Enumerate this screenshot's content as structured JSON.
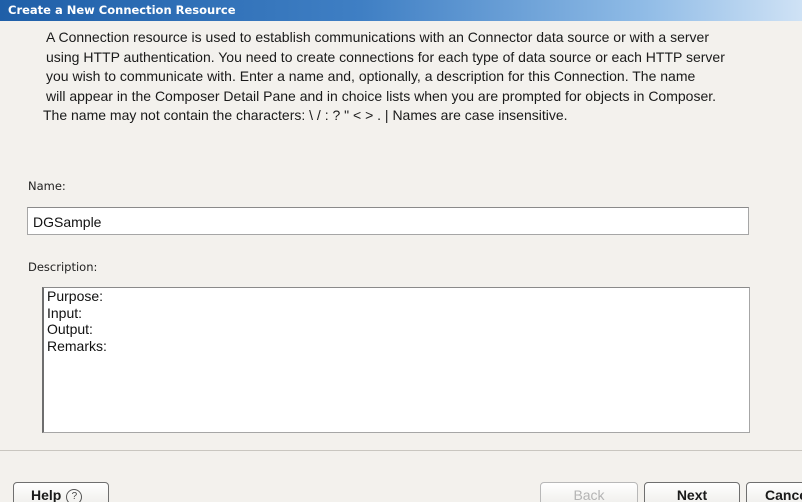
{
  "window": {
    "title": "Create a New Connection Resource"
  },
  "intro": {
    "lines": [
      "A Connection resource is used to establish communications with an Connector data source or with a server",
      "using HTTP authentication. You need to create connections for each type of data source or each HTTP server",
      "you wish to communicate with.  Enter a name and, optionally, a description for this Connection.  The name",
      "will appear in the Composer Detail Pane and in choice lists when you are prompted for objects in Composer.",
      " The name may not contain the characters: \\ / : ? \" < > . |  Names are case insensitive."
    ]
  },
  "form": {
    "name_label": "Name:",
    "name_value": "DGSample",
    "description_label": "Description:",
    "description_lines": [
      "Purpose:",
      "Input:",
      "Output:",
      "Remarks:"
    ]
  },
  "buttons": {
    "help": "Help",
    "help_icon": "?",
    "back": "Back",
    "next": "Next",
    "cancel": "Cancel"
  },
  "colors": {
    "titlebar_start": "#1f5fa8",
    "titlebar_end": "#cfe2f5",
    "background": "#f3f1ed"
  }
}
